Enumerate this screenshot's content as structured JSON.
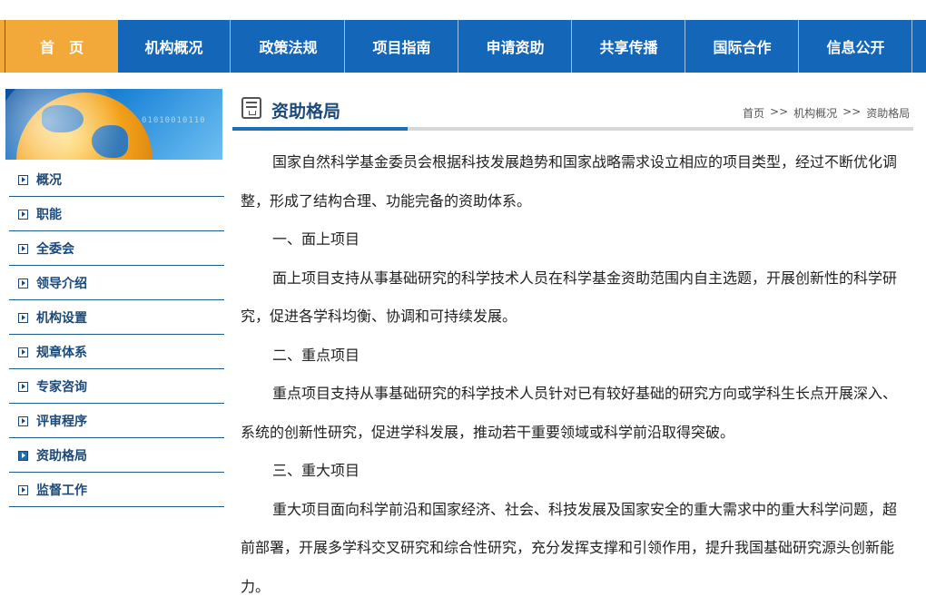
{
  "nav": {
    "items": [
      {
        "label": "首　页"
      },
      {
        "label": "机构概况"
      },
      {
        "label": "政策法规"
      },
      {
        "label": "项目指南"
      },
      {
        "label": "申请资助"
      },
      {
        "label": "共享传播"
      },
      {
        "label": "国际合作"
      },
      {
        "label": "信息公开"
      }
    ],
    "active_index": 0
  },
  "banner": {
    "digits": "01010010110"
  },
  "sidebar": {
    "items": [
      {
        "label": "概况"
      },
      {
        "label": "职能"
      },
      {
        "label": "全委会"
      },
      {
        "label": "领导介绍"
      },
      {
        "label": "机构设置"
      },
      {
        "label": "规章体系"
      },
      {
        "label": "专家咨询"
      },
      {
        "label": "评审程序"
      },
      {
        "label": "资助格局"
      },
      {
        "label": "监督工作"
      }
    ],
    "active_index": 8
  },
  "page": {
    "title": "资助格局",
    "breadcrumb": [
      "首页",
      "机构概况",
      "资助格局"
    ],
    "breadcrumb_sep": ">>"
  },
  "content": {
    "paragraphs": [
      "国家自然科学基金委员会根据科技发展趋势和国家战略需求设立相应的项目类型，经过不断优化调整，形成了结构合理、功能完备的资助体系。",
      "一、面上项目",
      "面上项目支持从事基础研究的科学技术人员在科学基金资助范围内自主选题，开展创新性的科学研究，促进各学科均衡、协调和可持续发展。",
      "二、重点项目",
      "重点项目支持从事基础研究的科学技术人员针对已有较好基础的研究方向或学科生长点开展深入、系统的创新性研究，促进学科发展，推动若干重要领域或科学前沿取得突破。",
      "三、重大项目",
      "重大项目面向科学前沿和国家经济、社会、科技发展及国家安全的重大需求中的重大科学问题，超前部署，开展多学科交叉研究和综合性研究，充分发挥支撑和引领作用，提升我国基础研究源头创新能力。"
    ]
  },
  "colors": {
    "nav_bg": "#1466b8",
    "nav_active": "#f2a93a",
    "sidebar_text": "#1b4a7a",
    "title_underline": "#1b6fb5"
  }
}
